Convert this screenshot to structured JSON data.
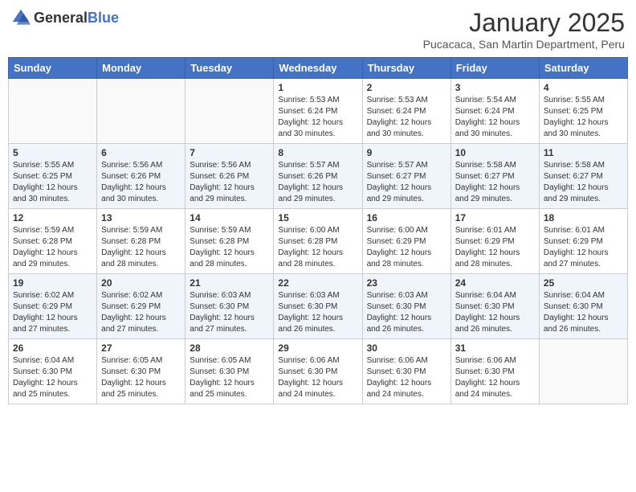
{
  "logo": {
    "general": "General",
    "blue": "Blue"
  },
  "title": "January 2025",
  "subtitle": "Pucacaca, San Martin Department, Peru",
  "weekdays": [
    "Sunday",
    "Monday",
    "Tuesday",
    "Wednesday",
    "Thursday",
    "Friday",
    "Saturday"
  ],
  "weeks": [
    [
      {
        "day": "",
        "info": ""
      },
      {
        "day": "",
        "info": ""
      },
      {
        "day": "",
        "info": ""
      },
      {
        "day": "1",
        "info": "Sunrise: 5:53 AM\nSunset: 6:24 PM\nDaylight: 12 hours and 30 minutes."
      },
      {
        "day": "2",
        "info": "Sunrise: 5:53 AM\nSunset: 6:24 PM\nDaylight: 12 hours and 30 minutes."
      },
      {
        "day": "3",
        "info": "Sunrise: 5:54 AM\nSunset: 6:24 PM\nDaylight: 12 hours and 30 minutes."
      },
      {
        "day": "4",
        "info": "Sunrise: 5:55 AM\nSunset: 6:25 PM\nDaylight: 12 hours and 30 minutes."
      }
    ],
    [
      {
        "day": "5",
        "info": "Sunrise: 5:55 AM\nSunset: 6:25 PM\nDaylight: 12 hours and 30 minutes."
      },
      {
        "day": "6",
        "info": "Sunrise: 5:56 AM\nSunset: 6:26 PM\nDaylight: 12 hours and 30 minutes."
      },
      {
        "day": "7",
        "info": "Sunrise: 5:56 AM\nSunset: 6:26 PM\nDaylight: 12 hours and 29 minutes."
      },
      {
        "day": "8",
        "info": "Sunrise: 5:57 AM\nSunset: 6:26 PM\nDaylight: 12 hours and 29 minutes."
      },
      {
        "day": "9",
        "info": "Sunrise: 5:57 AM\nSunset: 6:27 PM\nDaylight: 12 hours and 29 minutes."
      },
      {
        "day": "10",
        "info": "Sunrise: 5:58 AM\nSunset: 6:27 PM\nDaylight: 12 hours and 29 minutes."
      },
      {
        "day": "11",
        "info": "Sunrise: 5:58 AM\nSunset: 6:27 PM\nDaylight: 12 hours and 29 minutes."
      }
    ],
    [
      {
        "day": "12",
        "info": "Sunrise: 5:59 AM\nSunset: 6:28 PM\nDaylight: 12 hours and 29 minutes."
      },
      {
        "day": "13",
        "info": "Sunrise: 5:59 AM\nSunset: 6:28 PM\nDaylight: 12 hours and 28 minutes."
      },
      {
        "day": "14",
        "info": "Sunrise: 5:59 AM\nSunset: 6:28 PM\nDaylight: 12 hours and 28 minutes."
      },
      {
        "day": "15",
        "info": "Sunrise: 6:00 AM\nSunset: 6:28 PM\nDaylight: 12 hours and 28 minutes."
      },
      {
        "day": "16",
        "info": "Sunrise: 6:00 AM\nSunset: 6:29 PM\nDaylight: 12 hours and 28 minutes."
      },
      {
        "day": "17",
        "info": "Sunrise: 6:01 AM\nSunset: 6:29 PM\nDaylight: 12 hours and 28 minutes."
      },
      {
        "day": "18",
        "info": "Sunrise: 6:01 AM\nSunset: 6:29 PM\nDaylight: 12 hours and 27 minutes."
      }
    ],
    [
      {
        "day": "19",
        "info": "Sunrise: 6:02 AM\nSunset: 6:29 PM\nDaylight: 12 hours and 27 minutes."
      },
      {
        "day": "20",
        "info": "Sunrise: 6:02 AM\nSunset: 6:29 PM\nDaylight: 12 hours and 27 minutes."
      },
      {
        "day": "21",
        "info": "Sunrise: 6:03 AM\nSunset: 6:30 PM\nDaylight: 12 hours and 27 minutes."
      },
      {
        "day": "22",
        "info": "Sunrise: 6:03 AM\nSunset: 6:30 PM\nDaylight: 12 hours and 26 minutes."
      },
      {
        "day": "23",
        "info": "Sunrise: 6:03 AM\nSunset: 6:30 PM\nDaylight: 12 hours and 26 minutes."
      },
      {
        "day": "24",
        "info": "Sunrise: 6:04 AM\nSunset: 6:30 PM\nDaylight: 12 hours and 26 minutes."
      },
      {
        "day": "25",
        "info": "Sunrise: 6:04 AM\nSunset: 6:30 PM\nDaylight: 12 hours and 26 minutes."
      }
    ],
    [
      {
        "day": "26",
        "info": "Sunrise: 6:04 AM\nSunset: 6:30 PM\nDaylight: 12 hours and 25 minutes."
      },
      {
        "day": "27",
        "info": "Sunrise: 6:05 AM\nSunset: 6:30 PM\nDaylight: 12 hours and 25 minutes."
      },
      {
        "day": "28",
        "info": "Sunrise: 6:05 AM\nSunset: 6:30 PM\nDaylight: 12 hours and 25 minutes."
      },
      {
        "day": "29",
        "info": "Sunrise: 6:06 AM\nSunset: 6:30 PM\nDaylight: 12 hours and 24 minutes."
      },
      {
        "day": "30",
        "info": "Sunrise: 6:06 AM\nSunset: 6:30 PM\nDaylight: 12 hours and 24 minutes."
      },
      {
        "day": "31",
        "info": "Sunrise: 6:06 AM\nSunset: 6:30 PM\nDaylight: 12 hours and 24 minutes."
      },
      {
        "day": "",
        "info": ""
      }
    ]
  ]
}
